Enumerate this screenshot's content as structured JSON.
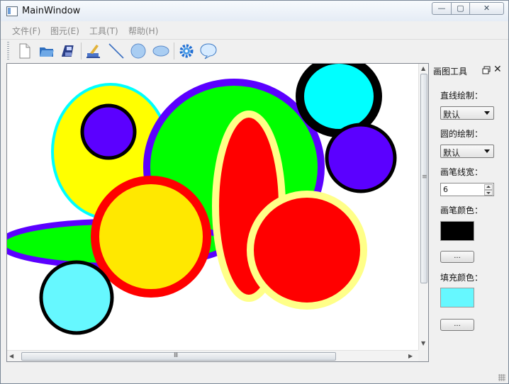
{
  "window": {
    "title": "MainWindow",
    "buttons": {
      "minimize": "—",
      "maximize": "▢",
      "close": "✕"
    }
  },
  "menu": {
    "items": [
      "文件(F)",
      "图元(E)",
      "工具(T)",
      "帮助(H)"
    ]
  },
  "toolbar": {
    "icons": [
      "new-file-icon",
      "open-folder-icon",
      "save-disk-icon",
      "brush-icon",
      "line-icon",
      "circle-icon",
      "ellipse-icon",
      "settings-gear-icon",
      "speech-bubble-icon"
    ]
  },
  "canvas": {
    "shapes": [
      {
        "type": "circle",
        "fill": "#ffff00",
        "stroke": "#00ffff"
      },
      {
        "type": "circle",
        "fill": "#5b00ff",
        "stroke": "#000000"
      },
      {
        "type": "circle",
        "fill": "#00ff00",
        "stroke": "#5b00ff"
      },
      {
        "type": "circle",
        "fill": "#00ffff",
        "stroke": "#000000"
      },
      {
        "type": "circle",
        "fill": "#5b00ff",
        "stroke": "#000000"
      },
      {
        "type": "ellipse",
        "fill": "#00ff00",
        "stroke": "#5b00ff"
      },
      {
        "type": "circle",
        "fill": "#ffe800",
        "stroke": "#ff0000"
      },
      {
        "type": "ellipse",
        "fill": "#ff0000",
        "stroke": "#ffff88"
      },
      {
        "type": "circle",
        "fill": "#ff0000",
        "stroke": "#ffff88"
      },
      {
        "type": "circle",
        "fill": "#66f8ff",
        "stroke": "#000000"
      }
    ]
  },
  "dock": {
    "title": "画图工具",
    "line_label": "直线绘制：",
    "line_value": "默认",
    "circle_label": "圆的绘制：",
    "circle_value": "默认",
    "pen_width_label": "画笔线宽：",
    "pen_width_value": "6",
    "pen_color_label": "画笔颜色：",
    "pen_color": "#000000",
    "pen_button": "...",
    "fill_color_label": "填充颜色：",
    "fill_color": "#66f8ff",
    "fill_button": "..."
  },
  "colors": {
    "scroll_grip": "Ⅲ",
    "vscroll_grip": "≡"
  }
}
